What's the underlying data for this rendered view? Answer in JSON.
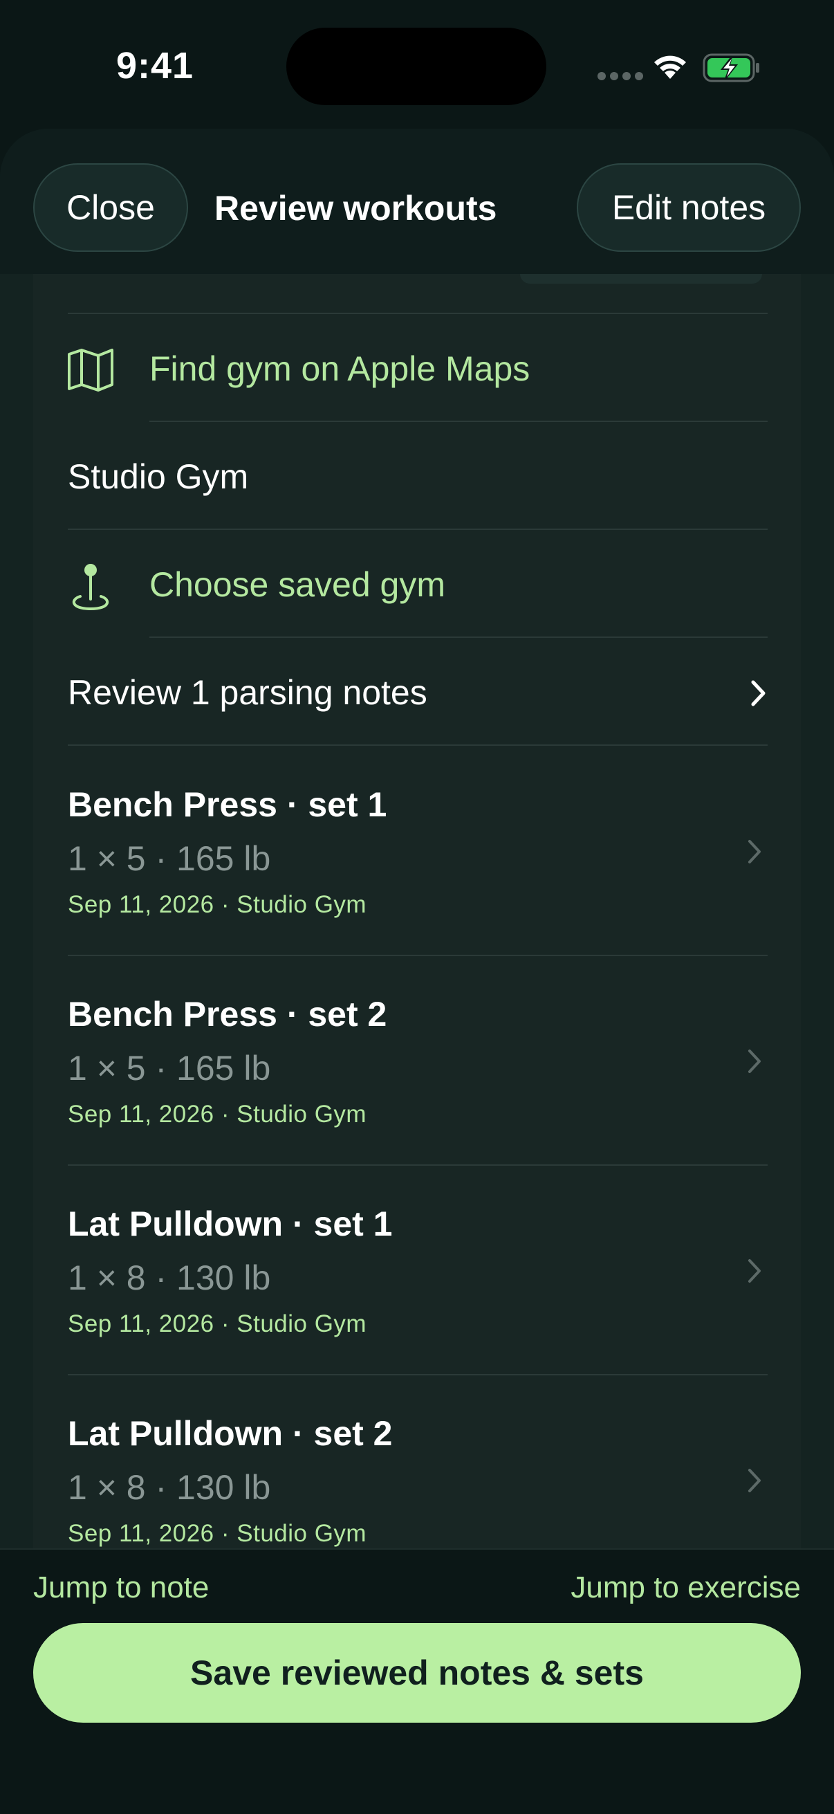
{
  "status_bar": {
    "time": "9:41"
  },
  "header": {
    "close_label": "Close",
    "title": "Review workouts",
    "edit_notes_label": "Edit notes"
  },
  "gym": {
    "find_label": "Find gym on Apple Maps",
    "find_icon": "map-icon",
    "current_gym": "Studio Gym",
    "choose_label": "Choose saved gym",
    "choose_icon": "map-pin-icon"
  },
  "parsing_notes": {
    "label": "Review 1 parsing notes"
  },
  "sets": [
    {
      "title": "Bench Press · set 1",
      "detail": "1 × 5 · 165 lb",
      "meta": "Sep 11, 2026 · Studio Gym"
    },
    {
      "title": "Bench Press · set 2",
      "detail": "1 × 5 · 165 lb",
      "meta": "Sep 11, 2026 · Studio Gym"
    },
    {
      "title": "Lat Pulldown · set 1",
      "detail": "1 × 8 · 130 lb",
      "meta": "Sep 11, 2026 · Studio Gym"
    },
    {
      "title": "Lat Pulldown · set 2",
      "detail": "1 × 8 · 130 lb",
      "meta": "Sep 11, 2026 · Studio Gym"
    }
  ],
  "bottom": {
    "jump_note": "Jump to note",
    "jump_exercise": "Jump to exercise",
    "save_label": "Save reviewed notes & sets"
  },
  "colors": {
    "accent": "#b4e8a0",
    "save_button": "#b9efa2",
    "background": "#0b1716",
    "card": "#182624"
  }
}
